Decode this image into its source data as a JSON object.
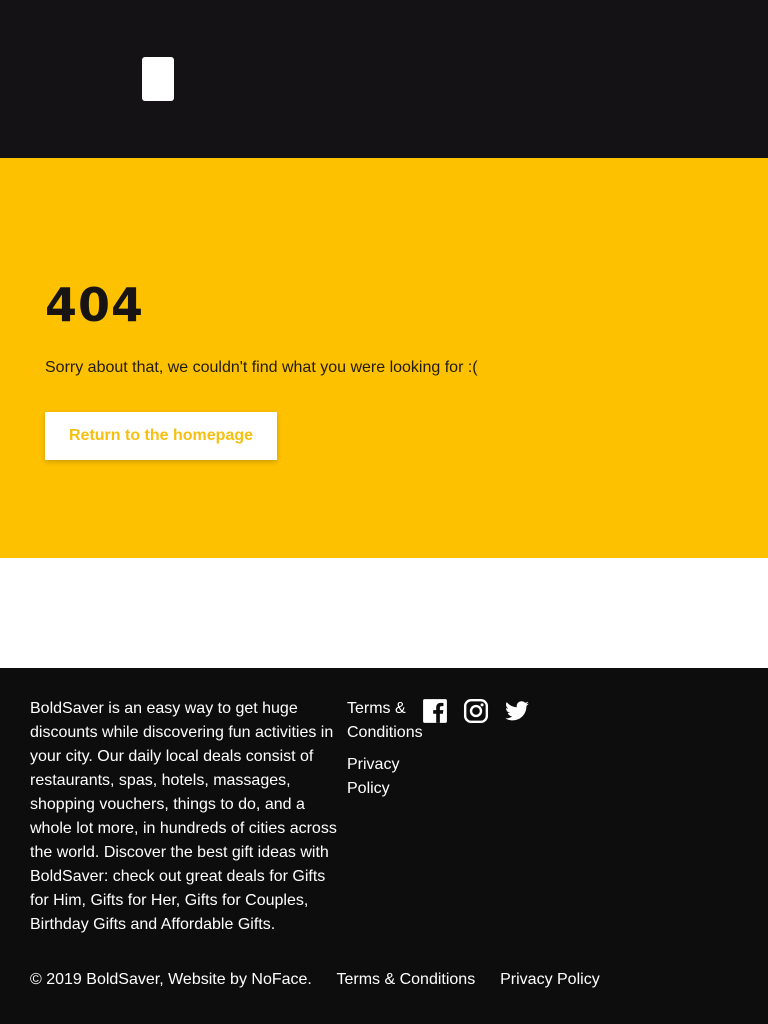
{
  "header": {
    "menu_button_color": "#ffffff",
    "background": "#141214"
  },
  "hero": {
    "background": "#fdc100",
    "code": "404",
    "message": "Sorry about that, we couldn't find what you were looking for :(",
    "button_label": "Return to the homepage"
  },
  "footer": {
    "about": "BoldSaver is an easy way to get huge discounts while discovering fun activities in your city. Our daily local deals consist of restaurants, spas, hotels, massages, shopping vouchers, things to do, and a whole lot more, in hundreds of cities across the world. Discover the best gift ideas with BoldSaver: check out great deals for Gifts for Him, Gifts for Her, Gifts for Couples, Birthday Gifts and Affordable Gifts.",
    "links": [
      {
        "label": "Terms & Conditions"
      },
      {
        "label": "Privacy Policy"
      }
    ],
    "social": [
      {
        "icon": "facebook-icon"
      },
      {
        "icon": "instagram-icon"
      },
      {
        "icon": "twitter-icon"
      }
    ],
    "copyright": "© 2019 BoldSaver, Website by NoFace.",
    "bottom_links": [
      {
        "label": "Terms & Conditions"
      },
      {
        "label": "Privacy Policy"
      }
    ]
  }
}
